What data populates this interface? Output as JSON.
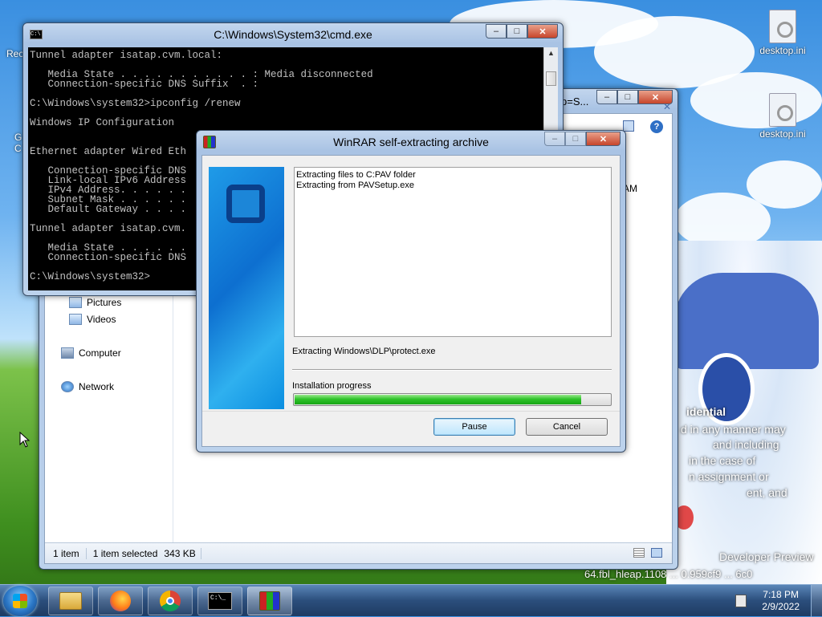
{
  "desktop": {
    "icons": [
      {
        "label": "desktop.ini"
      },
      {
        "label": "desktop.ini"
      }
    ],
    "left_fragments": [
      "Rec",
      "G",
      "C"
    ],
    "overlay_text": {
      "line1": "idential",
      "line2": "d in any manner may",
      "line3": "and including",
      "line4": "in the case of",
      "line5": "n assignment or",
      "line6": "ent, and",
      "line7": "Developer Preview",
      "line8": "64.fbl_hleap.1108 ... 0.959cf9 ... 6c0"
    }
  },
  "cmd": {
    "title": "C:\\Windows\\System32\\cmd.exe",
    "lines": [
      "Tunnel adapter isatap.cvm.local:",
      "",
      "   Media State . . . . . . . . . . . : Media disconnected",
      "   Connection-specific DNS Suffix  . :",
      "",
      "C:\\Windows\\system32>ipconfig /renew",
      "",
      "Windows IP Configuration",
      "",
      "",
      "Ethernet adapter Wired Eth",
      "",
      "   Connection-specific DNS",
      "   Link-local IPv6 Address",
      "   IPv4 Address. . . . . .",
      "   Subnet Mask . . . . . .",
      "   Default Gateway . . . .",
      "",
      "Tunnel adapter isatap.cvm.",
      "",
      "   Media State . . . . . .",
      "   Connection-specific DNS",
      "",
      "C:\\Windows\\system32>"
    ]
  },
  "explorer": {
    "title_fragment": "p=S...",
    "right_fragment": "AM",
    "nav": {
      "pictures": "Pictures",
      "videos": "Videos",
      "computer": "Computer",
      "network": "Network"
    },
    "status": {
      "count": "1 item",
      "selected": "1 item selected",
      "size": "343 KB"
    }
  },
  "winrar": {
    "title": "WinRAR self-extracting archive",
    "log": [
      "Extracting files to C:PAV folder",
      "Extracting from PAVSetup.exe"
    ],
    "current_file": "Extracting Windows\\DLP\\protect.exe",
    "progress_label": "Installation progress",
    "progress": 0.91,
    "pause_label": "Pause",
    "cancel_label": "Cancel"
  },
  "taskbar": {
    "time": "7:18 PM",
    "date": "2/9/2022",
    "cmd_glyph": "C:\\_"
  },
  "colors": {
    "progress": "#22b51f",
    "banner": "#1f9be8"
  }
}
